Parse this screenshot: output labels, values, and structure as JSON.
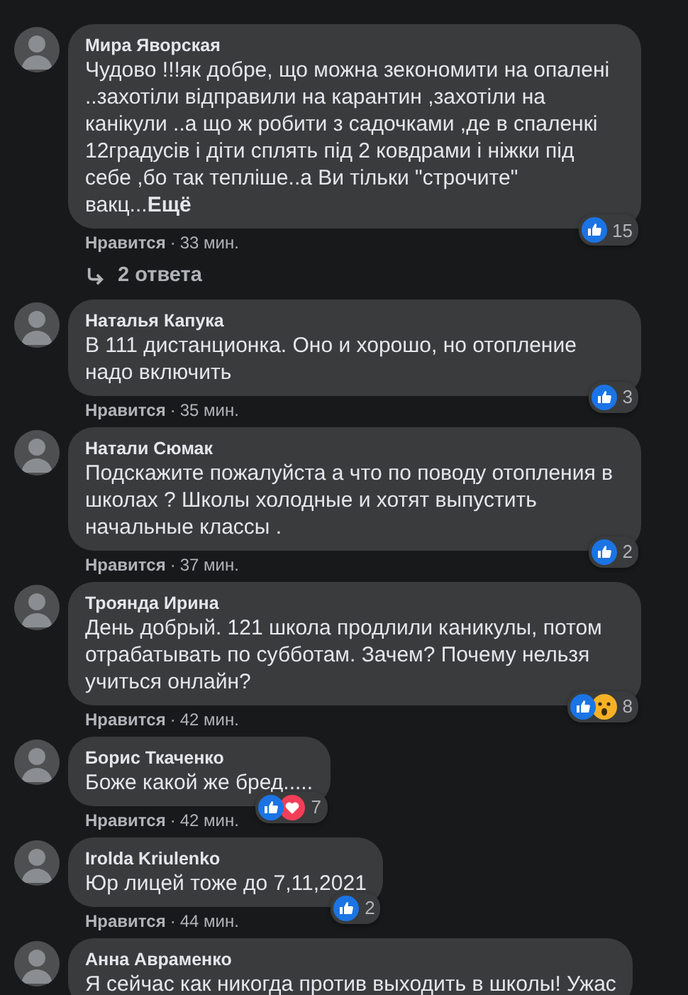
{
  "comments": [
    {
      "author": "Мира Яворская",
      "text": "Чудово !!!як добре, що можна зекономити на опалені ..захотіли відправили на карантин ,захотіли на канікули ..а що ж робити з садочками ,де в спаленкі 12градусів і діти сплять під 2 ковдрами і ніжки під себе ,бо так тепліше..а Ви тільки \"строчите\" вакц...",
      "more": "Ещё",
      "reactions": [
        {
          "kind": "like"
        }
      ],
      "reaction_count": "15",
      "like_label": "Нравится",
      "separator": "·",
      "time": "33 мин.",
      "replies": "2 ответа"
    },
    {
      "author": "Наталья Капука",
      "text": "В 111 дистанционка. Оно и хорошо, но отопление надо включить",
      "reactions": [
        {
          "kind": "like"
        }
      ],
      "reaction_count": "3",
      "like_label": "Нравится",
      "separator": "·",
      "time": "35 мин."
    },
    {
      "author": "Натали Сюмак",
      "text": "Подскажите пожалуйста а что по поводу отопления в школах ? Школы холодные и хотят выпустить начальные классы .",
      "reactions": [
        {
          "kind": "like"
        }
      ],
      "reaction_count": "2",
      "like_label": "Нравится",
      "separator": "·",
      "time": "37 мин."
    },
    {
      "author": "Троянда Ирина",
      "text": "День добрый. 121 школа продлили каникулы, потом отрабатывать по субботам. Зачем? Почему нельзя учиться онлайн?",
      "reactions": [
        {
          "kind": "like"
        },
        {
          "kind": "wow"
        }
      ],
      "reaction_count": "8",
      "like_label": "Нравится",
      "separator": "·",
      "time": "42 мин."
    },
    {
      "author": "Борис Ткаченко",
      "text": "Боже какой же бред.....",
      "reactions": [
        {
          "kind": "like"
        },
        {
          "kind": "love"
        }
      ],
      "reaction_count": "7",
      "like_label": "Нравится",
      "separator": "·",
      "time": "42 мин."
    },
    {
      "author": "Irolda Kriulenko",
      "text": "Юр лицей тоже до 7,11,2021",
      "reactions": [
        {
          "kind": "like"
        }
      ],
      "reaction_count": "2",
      "like_label": "Нравится",
      "separator": "·",
      "time": "44 мин."
    },
    {
      "author": "Анна Авраменко",
      "text": "Я сейчас как никогда против выходить в школы! Ужас"
    }
  ]
}
